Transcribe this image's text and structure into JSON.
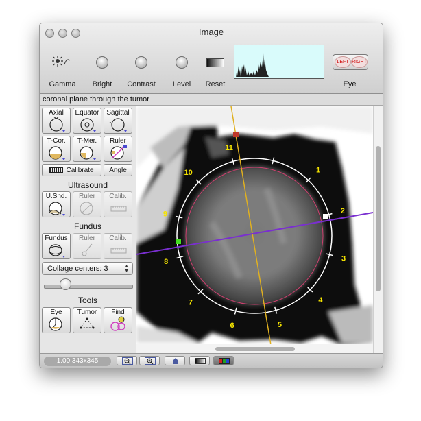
{
  "window": {
    "title": "Image"
  },
  "toolbar": {
    "gamma_label": "Gamma",
    "bright_label": "Bright",
    "contrast_label": "Contrast",
    "level_label": "Level",
    "reset_label": "Reset",
    "eye_label": "Eye",
    "eye_left_label": "LEFT",
    "eye_right_label": "RIGHT"
  },
  "caption": "coronal plane through the tumor",
  "sidebar": {
    "axial": "Axial",
    "equator": "Equator",
    "sagittal": "Sagittal",
    "tcor": "T-Cor.",
    "tmer": "T-Mer.",
    "ruler": "Ruler",
    "calibrate": "Calibrate",
    "angle": "Angle",
    "ultrasound_title": "Ultrasound",
    "usnd": "U.Snd.",
    "us_ruler": "Ruler",
    "us_calib": "Calib.",
    "fundus_title": "Fundus",
    "fundus": "Fundus",
    "f_ruler": "Ruler",
    "f_calib": "Calib.",
    "collage": "Collage centers: 3",
    "collage_slider_fraction": 0.2,
    "tools_title": "Tools",
    "eye": "Eye",
    "tumor": "Tumor",
    "find": "Find"
  },
  "viewer": {
    "clock_numbers": [
      "1",
      "2",
      "3",
      "4",
      "5",
      "6",
      "7",
      "8",
      "9",
      "10",
      "11"
    ]
  },
  "status": {
    "zoom": "1.00 343x345"
  },
  "colors": {
    "histogram_bg": "#d9fbfb",
    "meridian_line": "#e0b020",
    "axis_line": "#7a2fd0",
    "marker_red": "#c0392b",
    "marker_green": "#44dd22",
    "clock_text": "#f5e400",
    "tumor_ring": "#d04070"
  }
}
